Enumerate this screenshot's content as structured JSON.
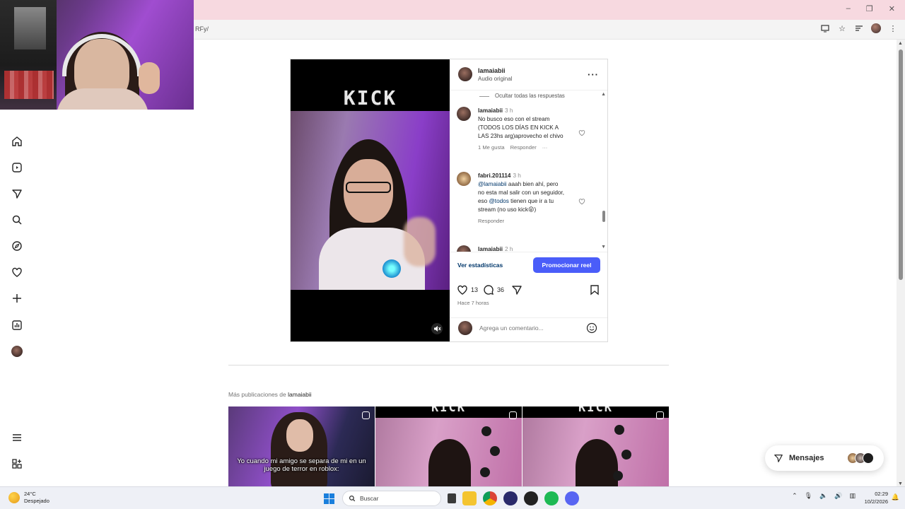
{
  "browser": {
    "url_fragment": "RFy/",
    "window_controls": [
      "–",
      "❐",
      "✕"
    ]
  },
  "post": {
    "username": "lamaiabii",
    "audio": "Audio original",
    "video_logo": "KICK",
    "hide_replies": "Ocultar todas las respuestas",
    "comments": [
      {
        "user": "lamaiabii",
        "time": "3 h",
        "text": "No busco eso con el stream (TODOS LOS DÍAS EN KICK A LAS 23hs arg)aprovecho el chivo",
        "likes": "1 Me gusta",
        "reply": "Responder",
        "more": "···"
      },
      {
        "user": "fabri.201114",
        "time": "3 h",
        "mention1": "@lamaiabii",
        "text1": "aaah bien ahí, pero no esta mal salir con un seguidor, eso",
        "mention2": "@todos",
        "text2": "tienen que ir a tu stream (no uso kick😜)",
        "reply": "Responder"
      },
      {
        "user": "lamaiabii",
        "time": "2 h"
      }
    ],
    "stats_link": "Ver estadísticas",
    "promote_button": "Promocionar reel",
    "likes_count": "13",
    "comments_count": "36",
    "time_ago": "Hace 7 horas",
    "comment_placeholder": "Agrega un comentario..."
  },
  "more_posts": {
    "prefix": "Más publicaciones de",
    "user": "lamaiabii",
    "thumbnails": [
      {
        "caption": "Yo cuando mi amigo se separa de mi en un juego de terror en roblox:"
      },
      {
        "caption": "KICK"
      },
      {
        "caption": "KICK"
      }
    ]
  },
  "messages": {
    "label": "Mensajes"
  },
  "taskbar": {
    "temperature": "24°C",
    "weather": "Despejado",
    "search_placeholder": "Buscar",
    "time": "02:29",
    "date": "10/2/2026"
  },
  "colors": {
    "titlebar": "#f7d9e0",
    "promote": "#4a5df9",
    "link": "#00376b"
  }
}
